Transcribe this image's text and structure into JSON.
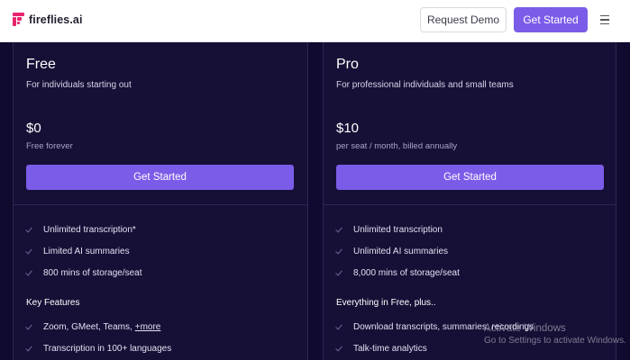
{
  "header": {
    "logo_text": "fireflies.ai",
    "request_demo_label": "Request Demo",
    "get_started_label": "Get Started",
    "brand_color": "#e8246f",
    "accent_color": "#7b5ce8"
  },
  "plans": [
    {
      "name": "Free",
      "description": "For individuals starting out",
      "price": "$0",
      "price_note": "Free forever",
      "cta_label": "Get Started",
      "features": [
        "Unlimited transcription*",
        "Limited AI summaries",
        "800 mins of storage/seat"
      ],
      "section_title": "Key Features",
      "key_features": [
        "Zoom, GMeet, Teams,",
        "Transcription in 100+ languages"
      ],
      "more_link": "+more"
    },
    {
      "name": "Pro",
      "description": "For professional individuals and small teams",
      "price": "$10",
      "price_note": "per seat / month, billed annually",
      "cta_label": "Get Started",
      "features": [
        "Unlimited transcription",
        "Unlimited AI summaries",
        "8,000 mins of storage/seat"
      ],
      "section_title": "Everything in Free, plus..",
      "key_features": [
        "Download transcripts, summaries, recordings",
        "Talk-time analytics"
      ]
    }
  ],
  "watermark": {
    "line1": "Activate Windows",
    "line2": "Go to Settings to activate Windows."
  }
}
